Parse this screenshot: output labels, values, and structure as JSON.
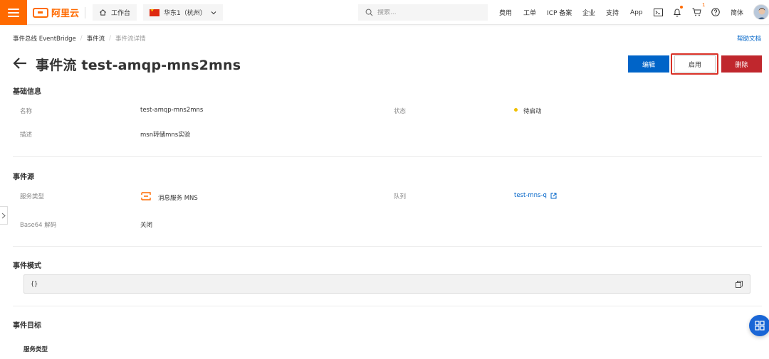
{
  "header": {
    "logo_text": "阿里云",
    "workbench_label": "工作台",
    "region_label": "华东1（杭州）",
    "search_placeholder": "搜索...",
    "nav": {
      "fees": "费用",
      "tickets": "工单",
      "icp": "ICP 备案",
      "enterprise": "企业",
      "support": "支持",
      "app": "App",
      "language": "简体"
    },
    "cart_count": "1"
  },
  "breadcrumb": {
    "items": [
      "事件总线 EventBridge",
      "事件流",
      "事件流详情"
    ],
    "separator": "/"
  },
  "help_link": "帮助文档",
  "page": {
    "title": "事件流 test-amqp-mns2mns"
  },
  "actions": {
    "edit": "编辑",
    "enable": "启用",
    "delete": "删除"
  },
  "basic_info": {
    "title": "基础信息",
    "name_label": "名称",
    "name_value": "test-amqp-mns2mns",
    "status_label": "状态",
    "status_value": "待启动",
    "desc_label": "描述",
    "desc_value": "msn转储mns实验"
  },
  "event_source": {
    "title": "事件源",
    "service_type_label": "服务类型",
    "service_type_value": "消息服务 MNS",
    "queue_label": "队列",
    "queue_value": "test-mns-q",
    "base64_label": "Base64 解码",
    "base64_value": "关闭"
  },
  "event_pattern": {
    "title": "事件模式",
    "code": "{}"
  },
  "event_target": {
    "title": "事件目标",
    "service_type_label": "服务类型"
  },
  "colors": {
    "brand": "#ff6a00",
    "primary": "#0064c8",
    "danger": "#c0272d",
    "highlight": "#d93026",
    "status_pending": "#f0c000"
  }
}
